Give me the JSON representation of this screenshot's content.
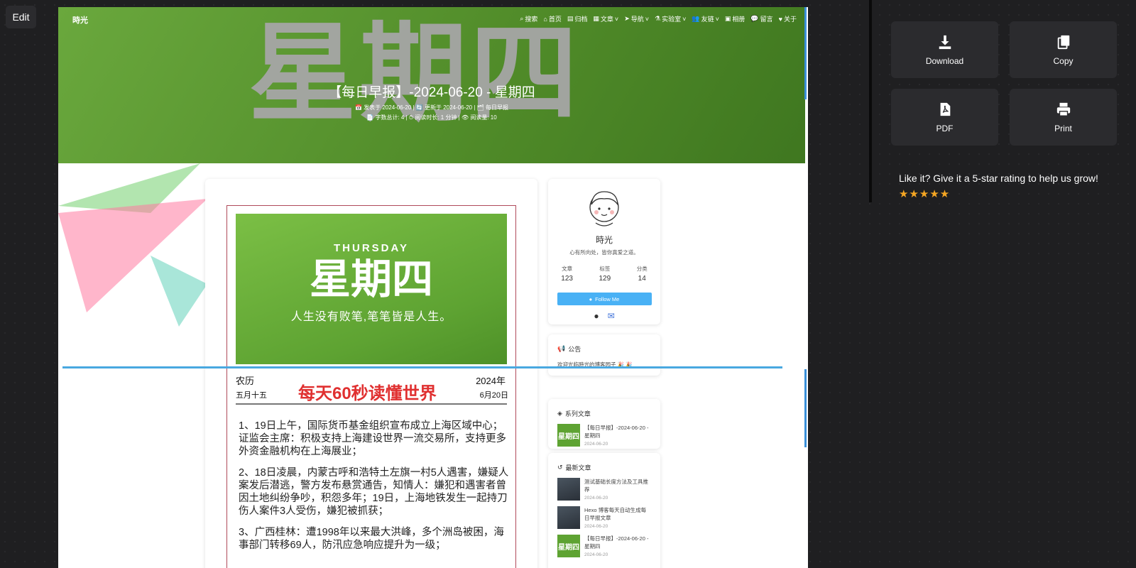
{
  "toolbar": {
    "edit_label": "Edit"
  },
  "hero": {
    "site_name": "時光",
    "big_text": "星期四",
    "title": "【每日早报】-2024-06-20 - 星期四",
    "meta_line1": "📅 发表于 2024-06-20 | 🔄 更新于 2024-06-20 | 🗂 每日早报",
    "meta_line2": "📄 字数总计: 4 | ⏱ 阅读时长: 1 分钟 | 👁 阅读量: 10",
    "nav": [
      "搜索",
      "首页",
      "归档",
      "文章",
      "导航",
      "实验室",
      "友链",
      "相册",
      "留言",
      "关于"
    ]
  },
  "post": {
    "banner_en": "THURSDAY",
    "banner_zh": "星期四",
    "banner_motto": "人生没有败笔,笔笔皆是人生。",
    "lunar_label": "农历",
    "lunar_date": "五月十五",
    "year": "2024年",
    "month_day": "6月20日",
    "headline": "每天60秒读懂世界",
    "news": [
      "1、19日上午，国际货币基金组织宣布成立上海区域中心；证监会主席：积极支持上海建设世界一流交易所，支持更多外资金融机构在上海展业；",
      "2、18日凌晨，内蒙古呼和浩特土左旗一村5人遇害，嫌疑人案发后潜逃，警方发布悬赏通告，知情人：嫌犯和遇害者曾因土地纠纷争吵，积怨多年；19日，上海地铁发生一起持刀伤人案件3人受伤，嫌犯被抓获；",
      "3、广西桂林：遭1998年以来最大洪峰，多个洲岛被困，海事部门转移69人，防汛应急响应提升为一级；"
    ]
  },
  "profile": {
    "name": "時光",
    "bio": "心有所向处，皆你真爱之道。",
    "stats": [
      {
        "label": "文章",
        "value": "123"
      },
      {
        "label": "标签",
        "value": "129"
      },
      {
        "label": "分类",
        "value": "14"
      }
    ],
    "follow_label": "Follow Me"
  },
  "announcement": {
    "title": "公告",
    "text": "欢迎光临時光的博客园子 🎉 🎉"
  },
  "series": {
    "title": "系列文章",
    "items": [
      {
        "title": "【每日早报】-2024-06-20 - 星期四",
        "date": "2024-06-20",
        "thumb": "星期四"
      }
    ]
  },
  "latest": {
    "title": "最新文章",
    "items": [
      {
        "title": "测试基础长度方法及工具推荐",
        "date": "2024-06-20"
      },
      {
        "title": "Hexo 博客每天自动生成每日早报文章",
        "date": "2024-06-20"
      },
      {
        "title": "【每日早报】-2024-06-20 - 星期四",
        "date": "2024-06-20",
        "thumb": "星期四"
      }
    ]
  },
  "actions": {
    "download": "Download",
    "copy": "Copy",
    "pdf": "PDF",
    "print": "Print"
  },
  "rating": {
    "text": "Like it? Give it a 5-star rating to help us grow!",
    "stars": "★★★★★"
  }
}
